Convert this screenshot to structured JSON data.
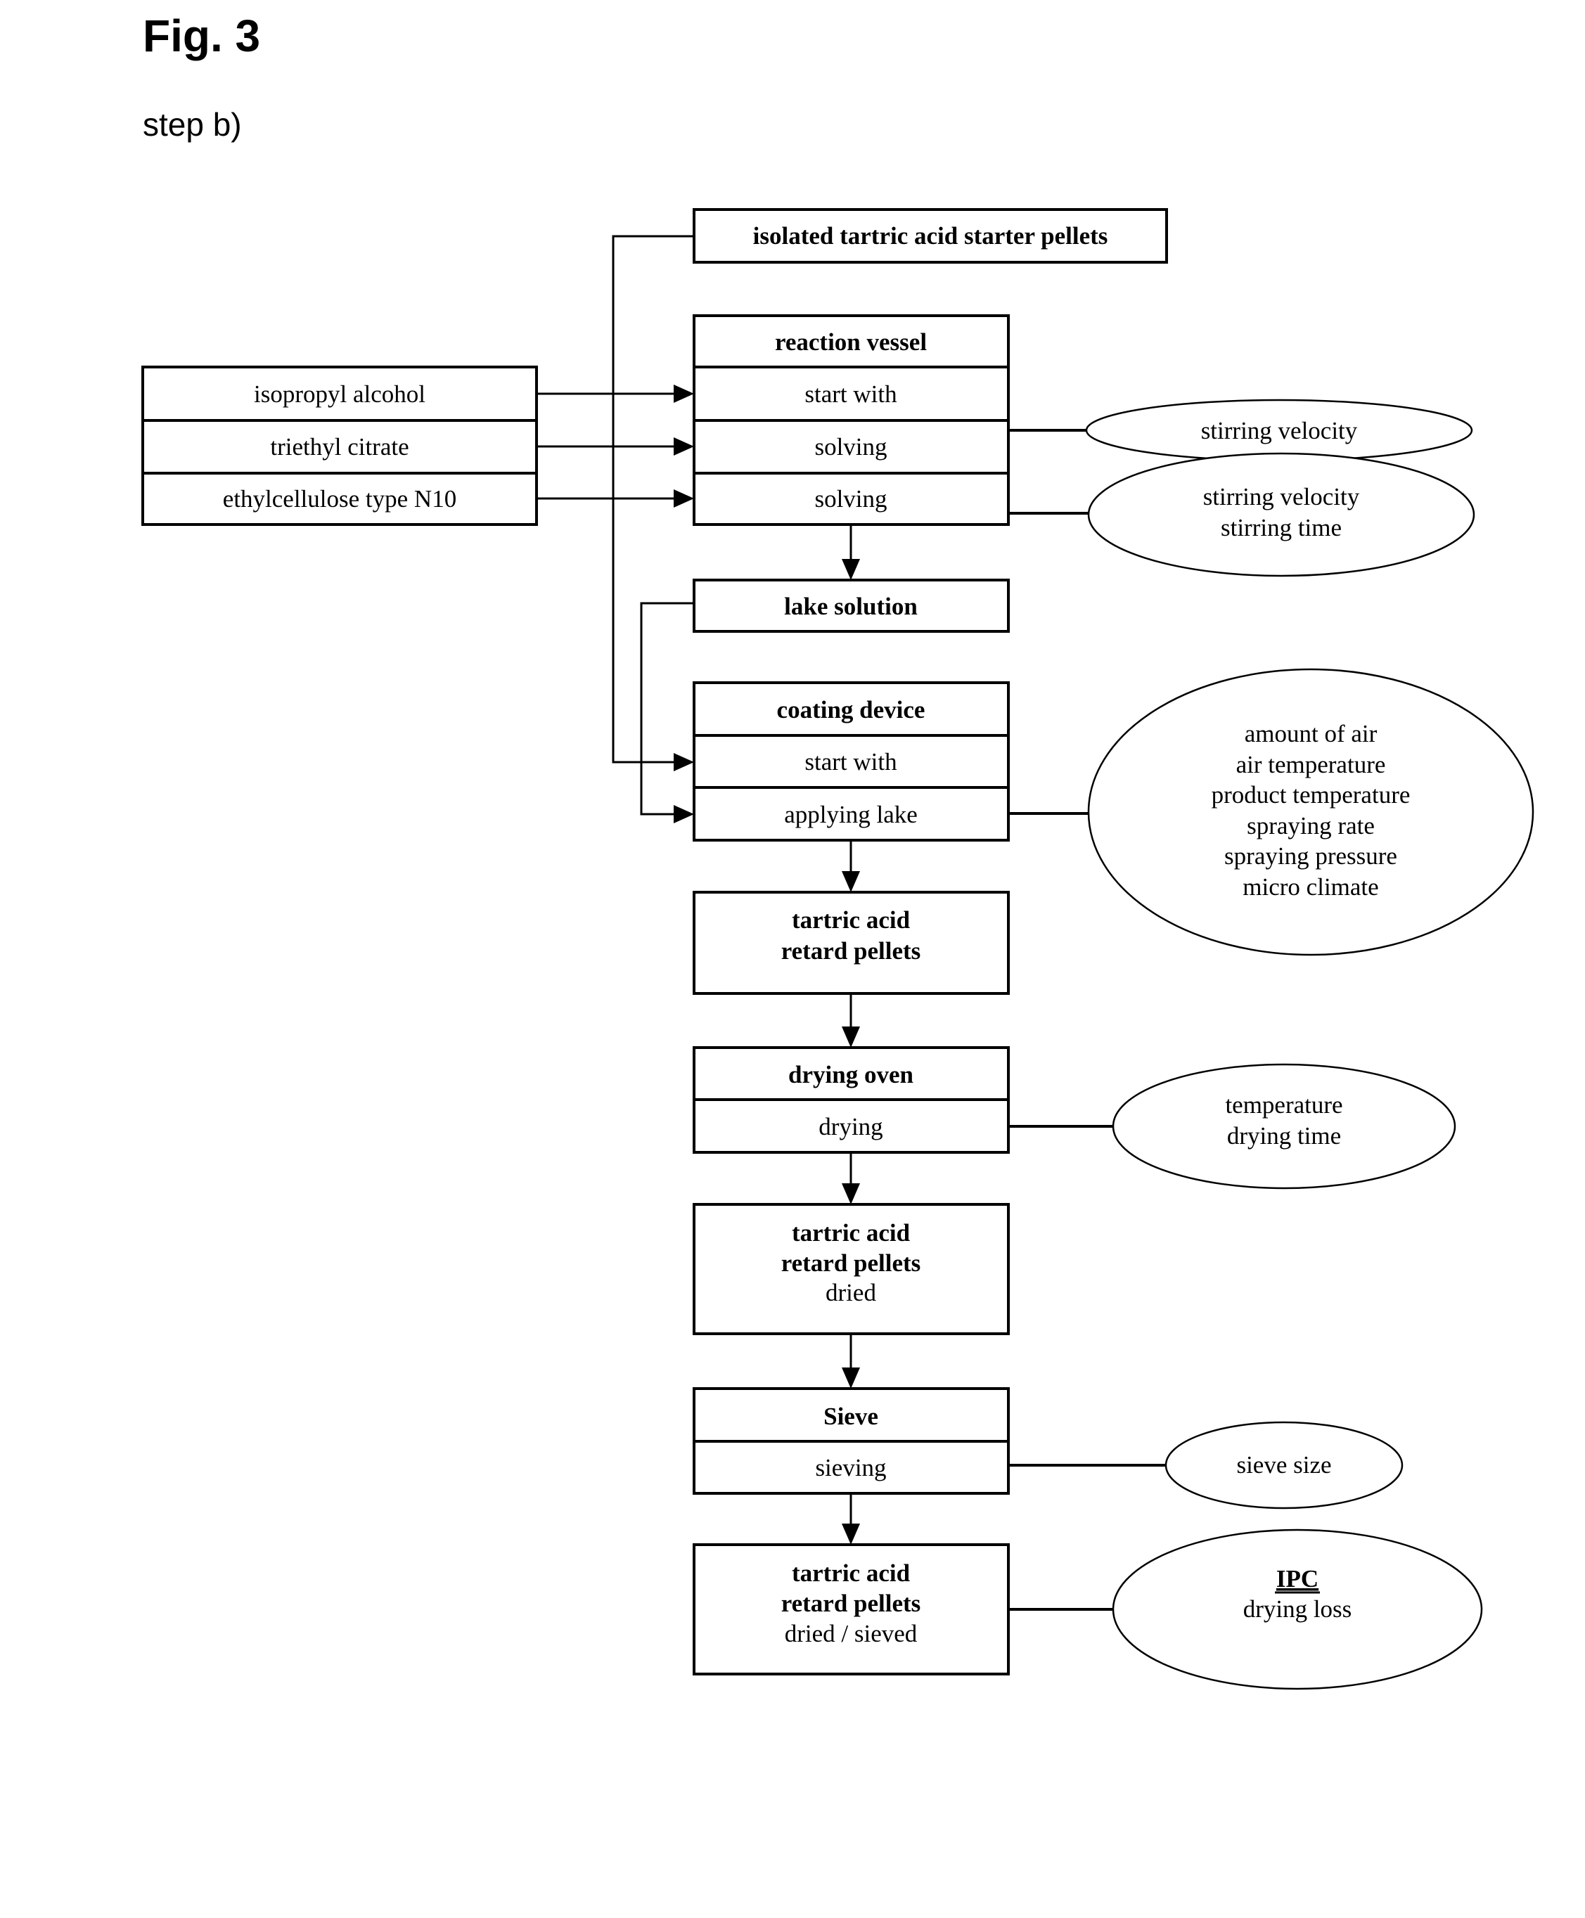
{
  "figure": {
    "title": "Fig. 3",
    "subtitle": "step b)"
  },
  "starter": {
    "label": "isolated tartric acid starter pellets"
  },
  "ingredients": [
    {
      "label": "isopropyl alcohol"
    },
    {
      "label": "triethyl citrate"
    },
    {
      "label": "ethylcellulose type N10"
    }
  ],
  "reaction_vessel": {
    "header": "reaction vessel",
    "rows": [
      "start with",
      "solving",
      "solving"
    ]
  },
  "lake_solution": {
    "label": "lake solution"
  },
  "coating_device": {
    "header": "coating device",
    "rows": [
      "start with",
      "applying lake"
    ]
  },
  "retard_pellets": {
    "line1": "tartric acid",
    "line2": "retard pellets"
  },
  "drying_oven": {
    "header": "drying oven",
    "rows": [
      "drying"
    ]
  },
  "retard_pellets_dried": {
    "line1": "tartric acid",
    "line2": "retard pellets",
    "line3": "dried"
  },
  "sieve": {
    "header": "Sieve",
    "rows": [
      "sieving"
    ]
  },
  "retard_pellets_final": {
    "line1": "tartric acid",
    "line2": "retard pellets",
    "line3": "dried / sieved"
  },
  "parameters": {
    "stirring1": [
      "stirring velocity"
    ],
    "stirring2": [
      "stirring velocity",
      "stirring time"
    ],
    "coating": [
      "amount of air",
      "air temperature",
      "product temperature",
      "spraying rate",
      "spraying pressure",
      "micro climate"
    ],
    "drying": [
      "temperature",
      "drying time"
    ],
    "sieve": [
      "sieve size"
    ],
    "ipc": {
      "heading": "IPC",
      "items": [
        "drying loss"
      ]
    }
  }
}
